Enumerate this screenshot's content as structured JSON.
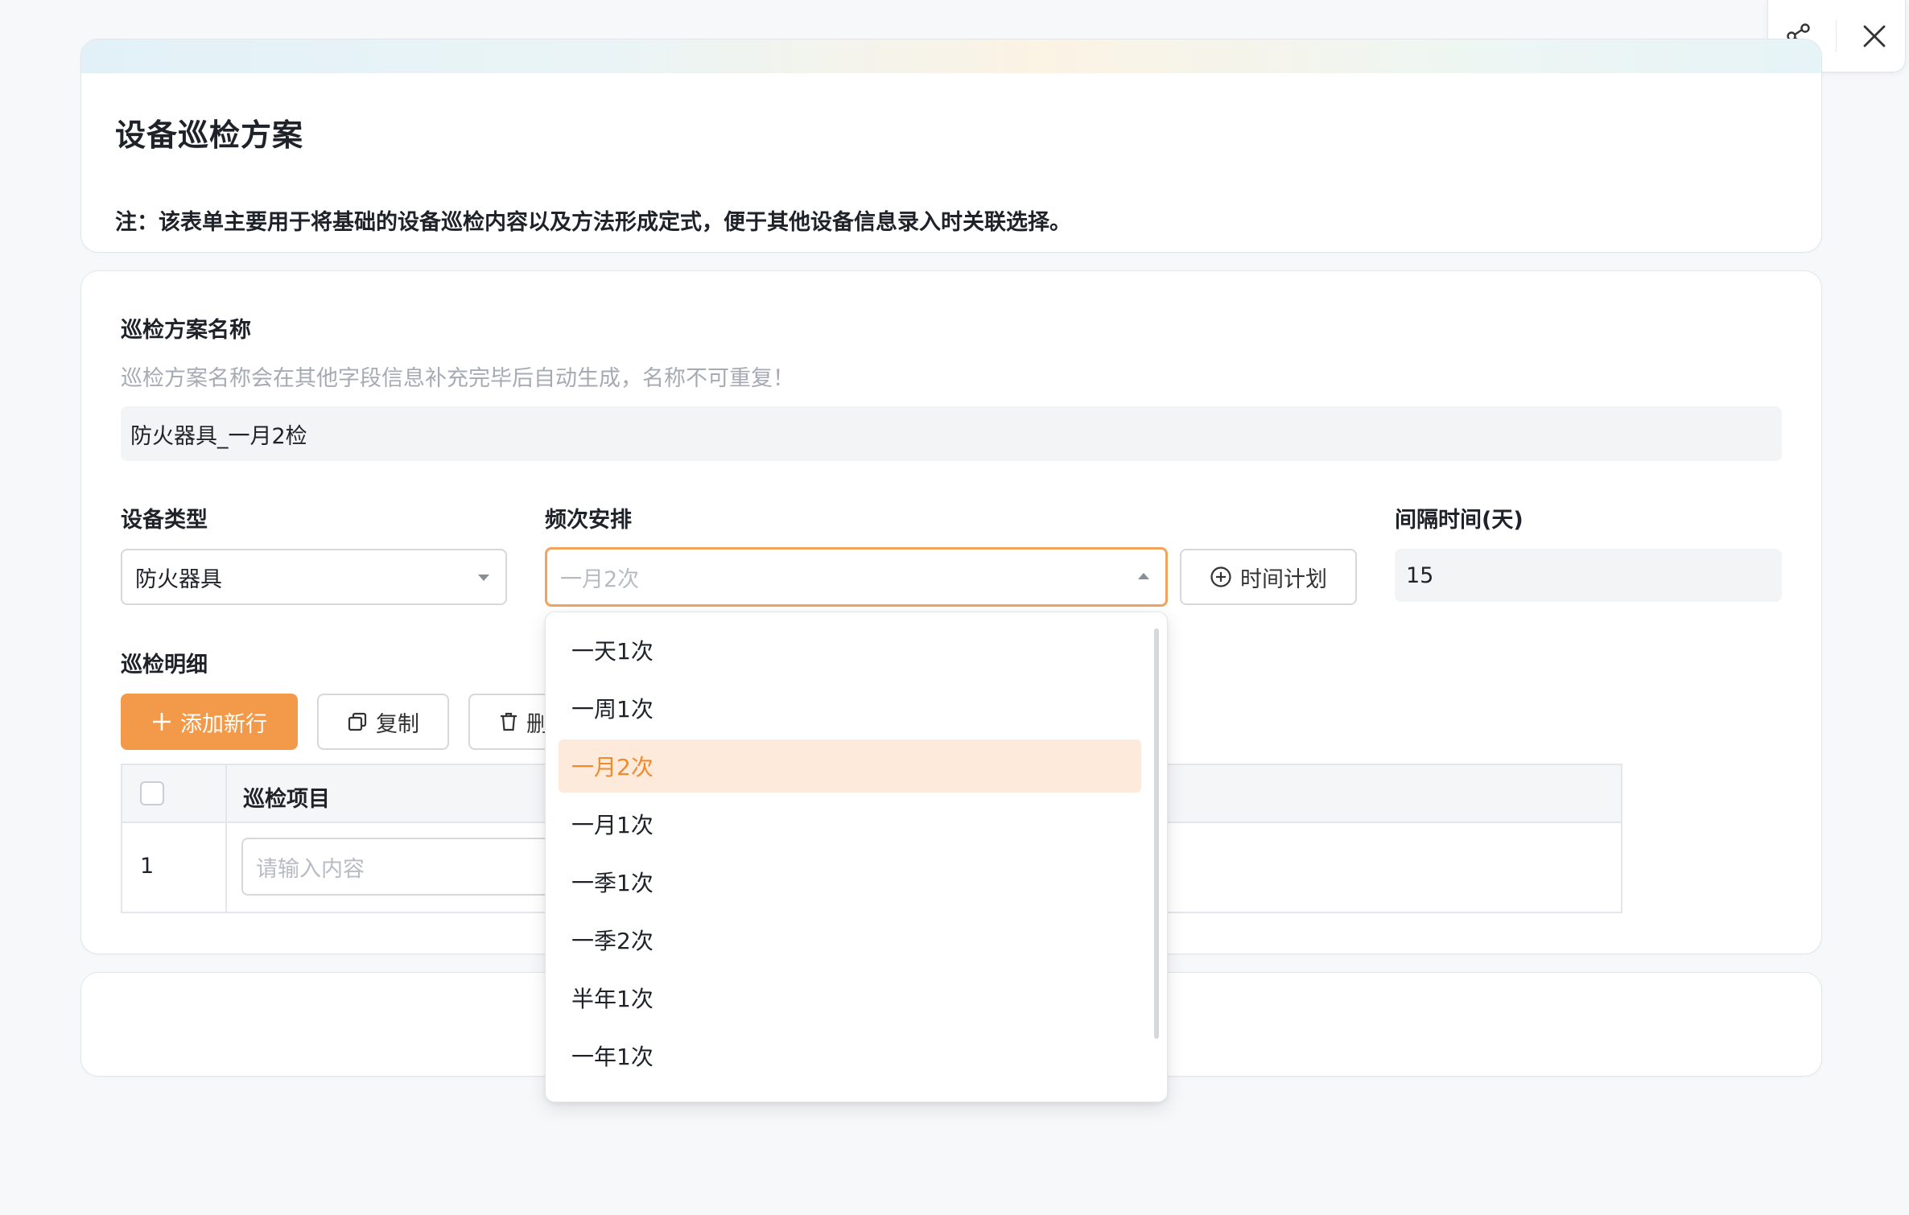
{
  "toolbar": {
    "share_icon": "share-icon",
    "close_icon": "close-icon"
  },
  "header": {
    "title": "设备巡检方案",
    "note": "注：该表单主要用于将基础的设备巡检内容以及方法形成定式，便于其他设备信息录入时关联选择。"
  },
  "form": {
    "plan_name": {
      "label": "巡检方案名称",
      "hint": "巡检方案名称会在其他字段信息补充完毕后自动生成，名称不可重复！",
      "value": "防火器具_一月2检"
    },
    "device_type": {
      "label": "设备类型",
      "value": "防火器具"
    },
    "frequency": {
      "label": "频次安排",
      "placeholder": "一月2次",
      "schedule_button": "时间计划"
    },
    "interval": {
      "label": "间隔时间(天)",
      "value": "15"
    }
  },
  "details": {
    "label": "巡检明细",
    "add_button": "添加新行",
    "copy_button": "复制",
    "delete_button_partial": "删",
    "columns": [
      "巡检项目"
    ],
    "rows": [
      {
        "index": "1",
        "item_placeholder": "请输入内容"
      }
    ]
  },
  "dropdown": {
    "options": [
      "一天1次",
      "一周1次",
      "一月2次",
      "一月1次",
      "一季1次",
      "一季2次",
      "半年1次",
      "一年1次"
    ],
    "selected": "一月2次"
  },
  "colors": {
    "accent": "#f39a4a",
    "selected_bg": "#fdeadb",
    "selected_text": "#f08a2e"
  }
}
